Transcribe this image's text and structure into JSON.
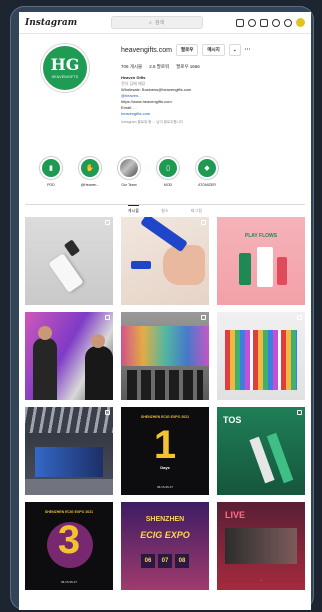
{
  "app": {
    "logo": "Instagram"
  },
  "nav": {
    "search_placeholder": "검색",
    "icons": [
      "home-icon",
      "messenger-icon",
      "add-post-icon",
      "explore-icon",
      "heart-icon",
      "profile-avatar"
    ]
  },
  "profile": {
    "username": "heavengifts.com",
    "follow_label": "팔로우",
    "message_label": "메시지",
    "stats": {
      "posts": "706 게시물",
      "followers": "2.6 팔로워",
      "following": "팔로우 1666"
    },
    "bio": {
      "name": "Heaven Gifts",
      "category": "전자 담배 매장",
      "lines": [
        "Wholesale: Business@heavengifts.com",
        "@heaven...",
        "https://www.heavengifts.com",
        "Email: ...",
        "heavengifts.com"
      ],
      "followed_by": "Instagram 팔로워 중 ... 님이 팔로우합니다"
    },
    "avatar_text": "HG",
    "avatar_sub": "HEAVENGIFTS"
  },
  "highlights": [
    {
      "label": "POD",
      "icon": "pod-icon"
    },
    {
      "label": "@Heaven...",
      "icon": "hand-icon"
    },
    {
      "label": "Our Team",
      "icon": "team-photo"
    },
    {
      "label": "MOD",
      "icon": "mod-icon"
    },
    {
      "label": "ATOMIZER",
      "icon": "atomizer-icon"
    }
  ],
  "tabs": [
    {
      "label": "게시물",
      "active": true
    },
    {
      "label": "릴스",
      "active": false
    },
    {
      "label": "태그됨",
      "active": false
    }
  ],
  "posts": [
    {
      "type": "device-photo"
    },
    {
      "type": "hand-device"
    },
    {
      "type": "product-lineup",
      "title": "PLAY FLOWS"
    },
    {
      "type": "people-booth"
    },
    {
      "type": "expo-crowd"
    },
    {
      "type": "expo-colorful-booth"
    },
    {
      "type": "expo-hall"
    },
    {
      "type": "countdown",
      "top": "SHENZHEN ECIG EXPO 2021",
      "number": "1",
      "caption": "Days",
      "footer": "06.15-06.17"
    },
    {
      "type": "promo",
      "title": "TOS"
    },
    {
      "type": "countdown",
      "top": "SHENZHEN ECIG EXPO 2021",
      "number": "3",
      "caption": "Days",
      "footer": "06.15-06.17"
    },
    {
      "type": "ecig-expo",
      "line1": "SHENZHEN",
      "line2": "ECIG EXPO",
      "clock": [
        "06",
        "07",
        "08"
      ]
    },
    {
      "type": "live",
      "title": "LIVE",
      "caption": "..."
    }
  ]
}
